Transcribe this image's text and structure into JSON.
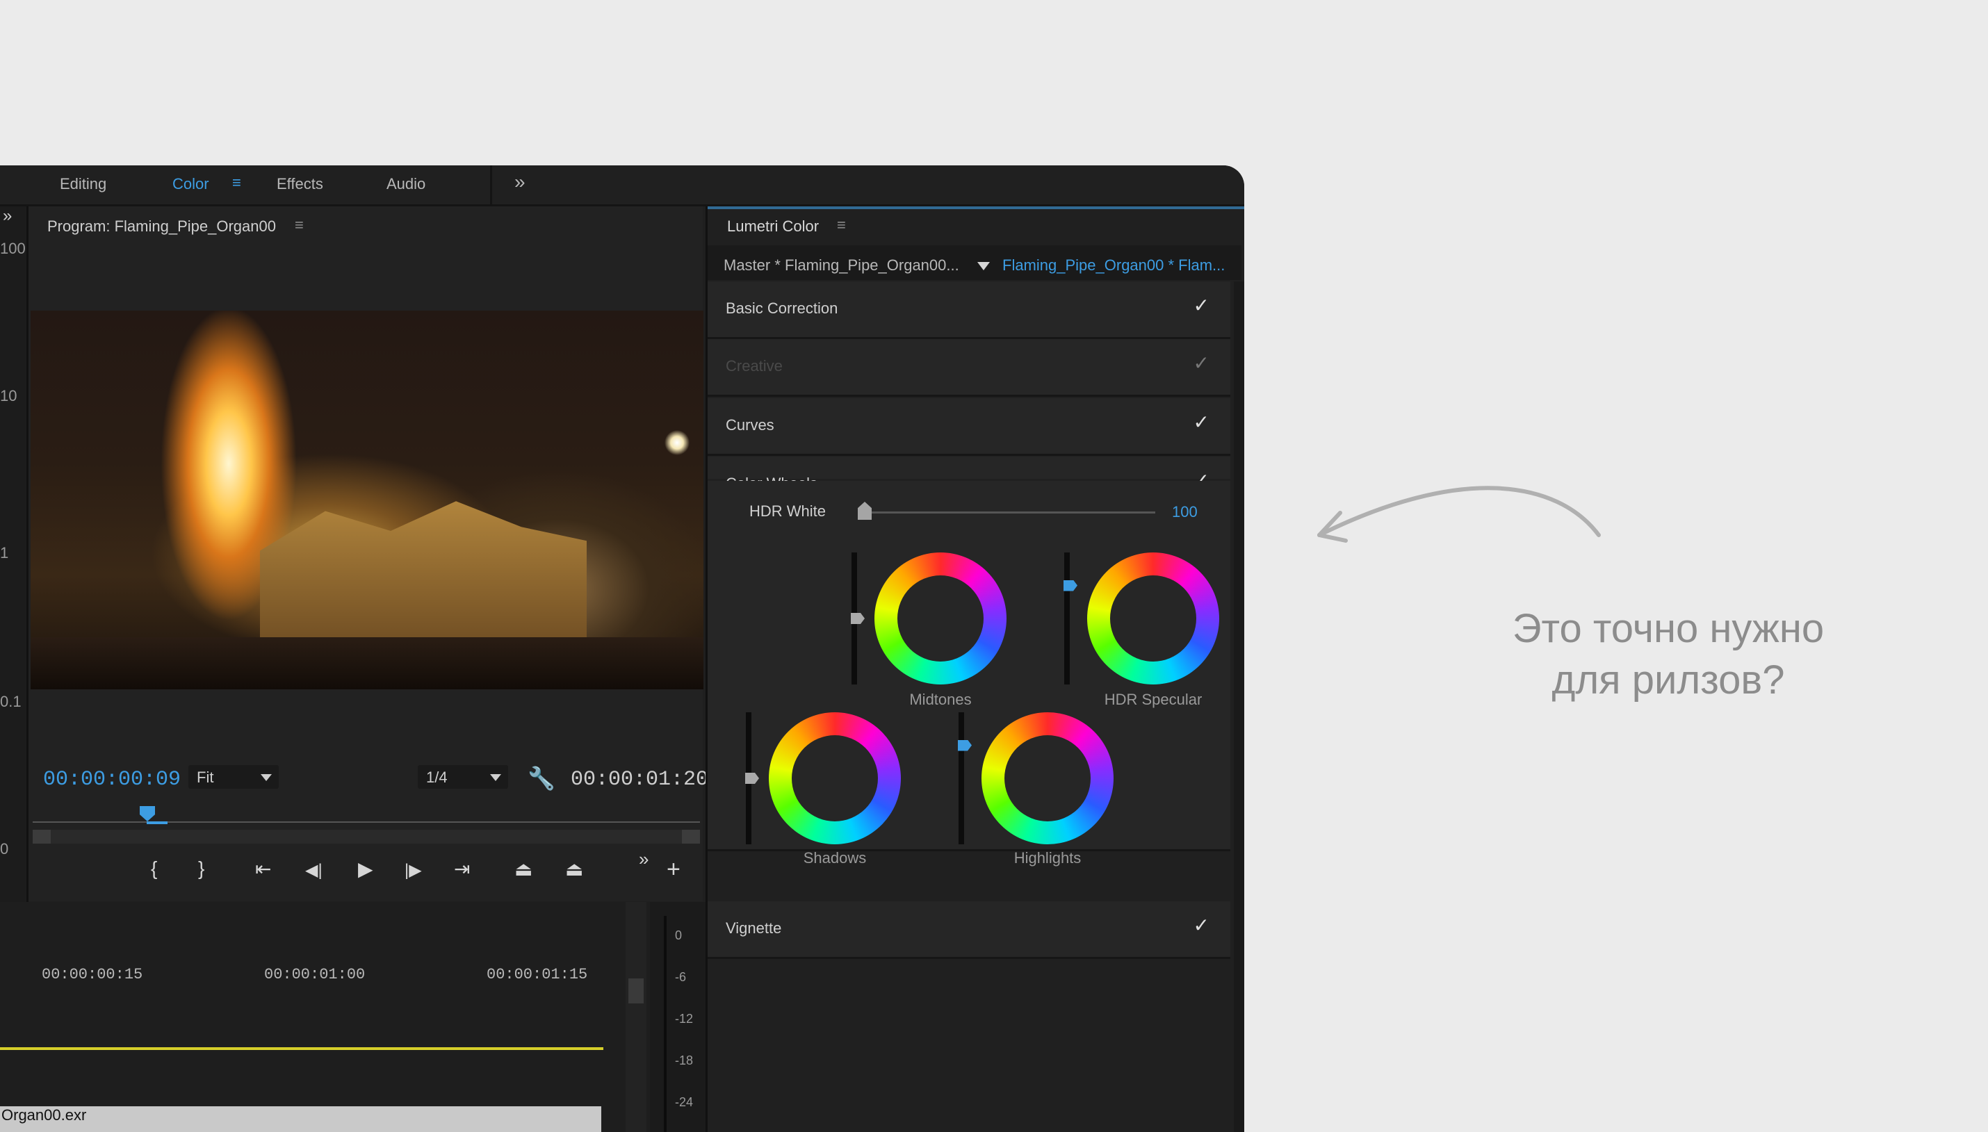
{
  "workspace": {
    "tabs": [
      "Editing",
      "Color",
      "Effects",
      "Audio"
    ],
    "active_tab": "Color",
    "more_label": "»"
  },
  "left_panel": {
    "expand_label": "»",
    "scale_labels": [
      "100",
      "10",
      "1",
      "0.1",
      "0"
    ]
  },
  "program_monitor": {
    "title": "Program: Flaming_Pipe_Organ00",
    "current_timecode": "00:00:00:09",
    "zoom": "Fit",
    "resolution": "1/4",
    "duration": "00:00:01:20",
    "transport": {
      "mark_in": "{",
      "mark_out": "}",
      "go_to_in": "⇤",
      "step_back": "◀|",
      "play": "▶",
      "step_forward": "|▶",
      "go_to_out": "⇥",
      "lift": "⏏",
      "extract": "⏏",
      "more": "»",
      "add": "+"
    }
  },
  "timeline": {
    "timecodes": [
      "00:00:00:15",
      "00:00:01:00",
      "00:00:01:15"
    ],
    "clip_name": "Organ00.exr",
    "meter_labels": [
      "0",
      "-6",
      "-12",
      "-18",
      "-24"
    ]
  },
  "lumetri": {
    "title": "Lumetri Color",
    "clip_master": "Master * Flaming_Pipe_Organ00...",
    "clip_active": "Flaming_Pipe_Organ00 * Flam...",
    "sections": [
      {
        "title": "Basic Correction",
        "enabled": true
      },
      {
        "title": "Creative",
        "enabled": true
      },
      {
        "title": "Curves",
        "enabled": true
      },
      {
        "title": "Color Wheels",
        "enabled": true
      },
      {
        "title": "Vignette",
        "enabled": true
      }
    ],
    "check_glyph": "✓",
    "hdr_white": {
      "label": "HDR White",
      "value": "100",
      "level": 0.0
    },
    "wheels": [
      {
        "label": "Midtones",
        "slider_level": 0.5,
        "knob_color": "#aaaaaa"
      },
      {
        "label": "HDR Specular",
        "slider_level": 0.75,
        "knob_color": "#3d9de3"
      },
      {
        "label": "Shadows",
        "slider_level": 0.5,
        "knob_color": "#aaaaaa"
      },
      {
        "label": "Highlights",
        "slider_level": 0.75,
        "knob_color": "#3d9de3"
      }
    ]
  },
  "annotation": {
    "line1": "Это точно нужно",
    "line2": "для рилзов?"
  },
  "colors": {
    "accent": "#3d9de3",
    "workarea": "#d6cf2a",
    "page_bg": "#ebebeb"
  }
}
